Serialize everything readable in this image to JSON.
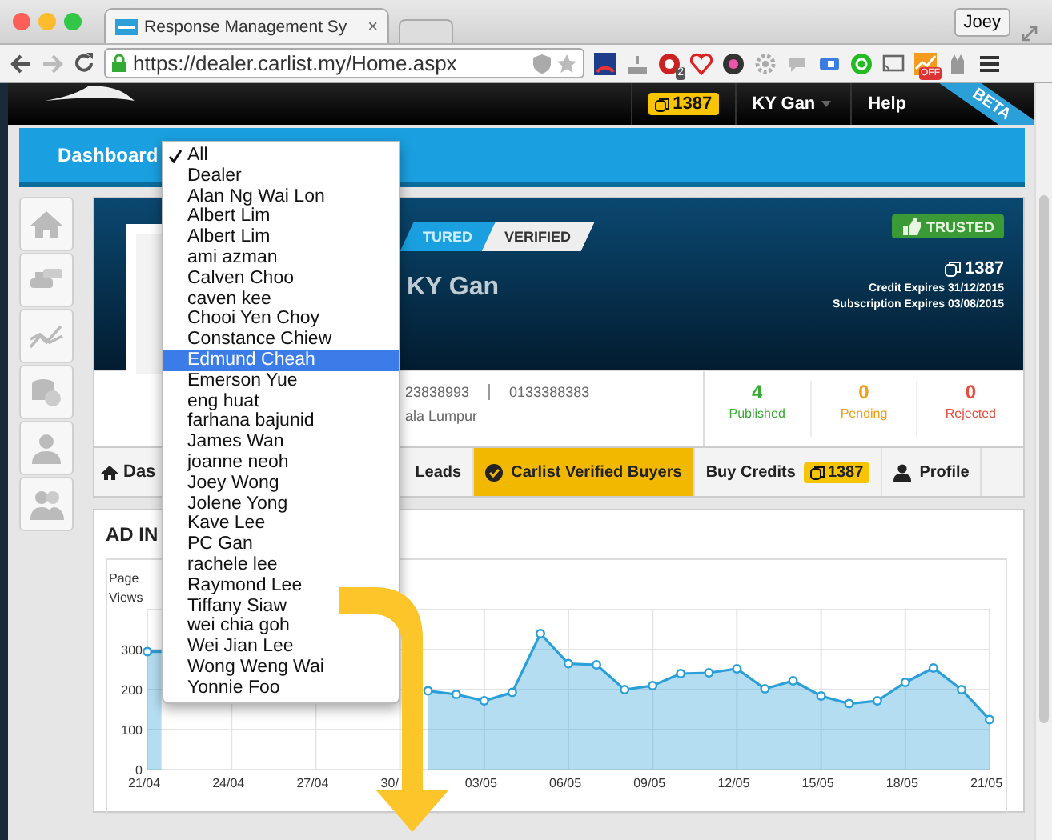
{
  "browser": {
    "tab_title": "Response Management Sy",
    "tab_close": "×",
    "profile": "Joey",
    "url": "https://dealer.carlist.my/Home.aspx",
    "extension_badges": [
      "2",
      "OFF"
    ]
  },
  "header": {
    "credits": "1387",
    "user": "KY Gan",
    "help": "Help",
    "ribbon": "BETA"
  },
  "toolbar": {
    "title": "Dashboard"
  },
  "profile": {
    "badges": [
      {
        "label": "TURED",
        "kind": "featured"
      },
      {
        "label": "VERIFIED",
        "kind": "verified"
      }
    ],
    "name": "KY Gan",
    "trusted": "TRUSTED",
    "credits": "1387",
    "credit_expires": "Credit Expires 31/12/2015",
    "subscription_expires": "Subscription Expires 03/08/2015",
    "phones": [
      "23838993",
      "0133388383"
    ],
    "location": "ala Lumpur",
    "stats": [
      {
        "value": "4",
        "label": "Published",
        "color": "#3aaa35"
      },
      {
        "value": "0",
        "label": "Pending",
        "color": "#f39c12"
      },
      {
        "value": "0",
        "label": "Rejected",
        "color": "#e74c3c"
      }
    ]
  },
  "nav_tabs": [
    {
      "label": "Das",
      "selected": false,
      "kind": "home"
    },
    {
      "label": "Leads",
      "selected": false,
      "kind": "plain"
    },
    {
      "label": "Carlist Verified Buyers",
      "selected": true,
      "kind": "check"
    },
    {
      "label": "Buy Credits",
      "selected": false,
      "kind": "credits",
      "badge": "1387"
    },
    {
      "label": "Profile",
      "selected": false,
      "kind": "person"
    }
  ],
  "panel": {
    "title": "AD IN",
    "chart_data": {
      "type": "area",
      "ylabel": "Page Views",
      "grid": true,
      "ylim": [
        0,
        400
      ],
      "yticks": [
        0,
        100,
        200,
        300
      ],
      "categories": [
        "21/04",
        null,
        null,
        "24/04",
        null,
        null,
        "27/04",
        null,
        null,
        "30/",
        null,
        null,
        "03/05",
        null,
        null,
        "06/05",
        null,
        null,
        "09/05",
        null,
        null,
        "12/05",
        null,
        null,
        "15/05",
        null,
        null,
        "18/05",
        null,
        null,
        "21/05"
      ],
      "series": [
        {
          "color": "#2a9fd8",
          "values": [
            295,
            null,
            null,
            null,
            null,
            null,
            null,
            null,
            null,
            null,
            197,
            188,
            172,
            193,
            340,
            265,
            262,
            200,
            210,
            240,
            242,
            252,
            202,
            222,
            184,
            165,
            172,
            218,
            254,
            200,
            125
          ]
        }
      ]
    }
  },
  "dropdown": {
    "items": [
      {
        "label": "All",
        "checked": true,
        "selected": false
      },
      {
        "label": "Dealer",
        "checked": false,
        "selected": false
      },
      {
        "label": "Alan Ng Wai Lon",
        "checked": false,
        "selected": false
      },
      {
        "label": "Albert Lim",
        "checked": false,
        "selected": false
      },
      {
        "label": "Albert Lim",
        "checked": false,
        "selected": false
      },
      {
        "label": "ami azman",
        "checked": false,
        "selected": false
      },
      {
        "label": "Calven Choo",
        "checked": false,
        "selected": false
      },
      {
        "label": "caven kee",
        "checked": false,
        "selected": false
      },
      {
        "label": "Chooi Yen Choy",
        "checked": false,
        "selected": false
      },
      {
        "label": "Constance Chiew",
        "checked": false,
        "selected": false
      },
      {
        "label": "Edmund Cheah",
        "checked": false,
        "selected": true
      },
      {
        "label": "Emerson Yue",
        "checked": false,
        "selected": false
      },
      {
        "label": "eng huat",
        "checked": false,
        "selected": false
      },
      {
        "label": "farhana bajunid",
        "checked": false,
        "selected": false
      },
      {
        "label": "James Wan",
        "checked": false,
        "selected": false
      },
      {
        "label": "joanne neoh",
        "checked": false,
        "selected": false
      },
      {
        "label": "Joey Wong",
        "checked": false,
        "selected": false
      },
      {
        "label": "Jolene Yong",
        "checked": false,
        "selected": false
      },
      {
        "label": "Kave Lee",
        "checked": false,
        "selected": false
      },
      {
        "label": "PC Gan",
        "checked": false,
        "selected": false
      },
      {
        "label": "rachele lee",
        "checked": false,
        "selected": false
      },
      {
        "label": "Raymond Lee",
        "checked": false,
        "selected": false
      },
      {
        "label": "Tiffany Siaw",
        "checked": false,
        "selected": false
      },
      {
        "label": "wei chia goh",
        "checked": false,
        "selected": false
      },
      {
        "label": "Wei Jian Lee",
        "checked": false,
        "selected": false
      },
      {
        "label": "Wong Weng Wai",
        "checked": false,
        "selected": false
      },
      {
        "label": "Yonnie Foo",
        "checked": false,
        "selected": false
      }
    ]
  }
}
